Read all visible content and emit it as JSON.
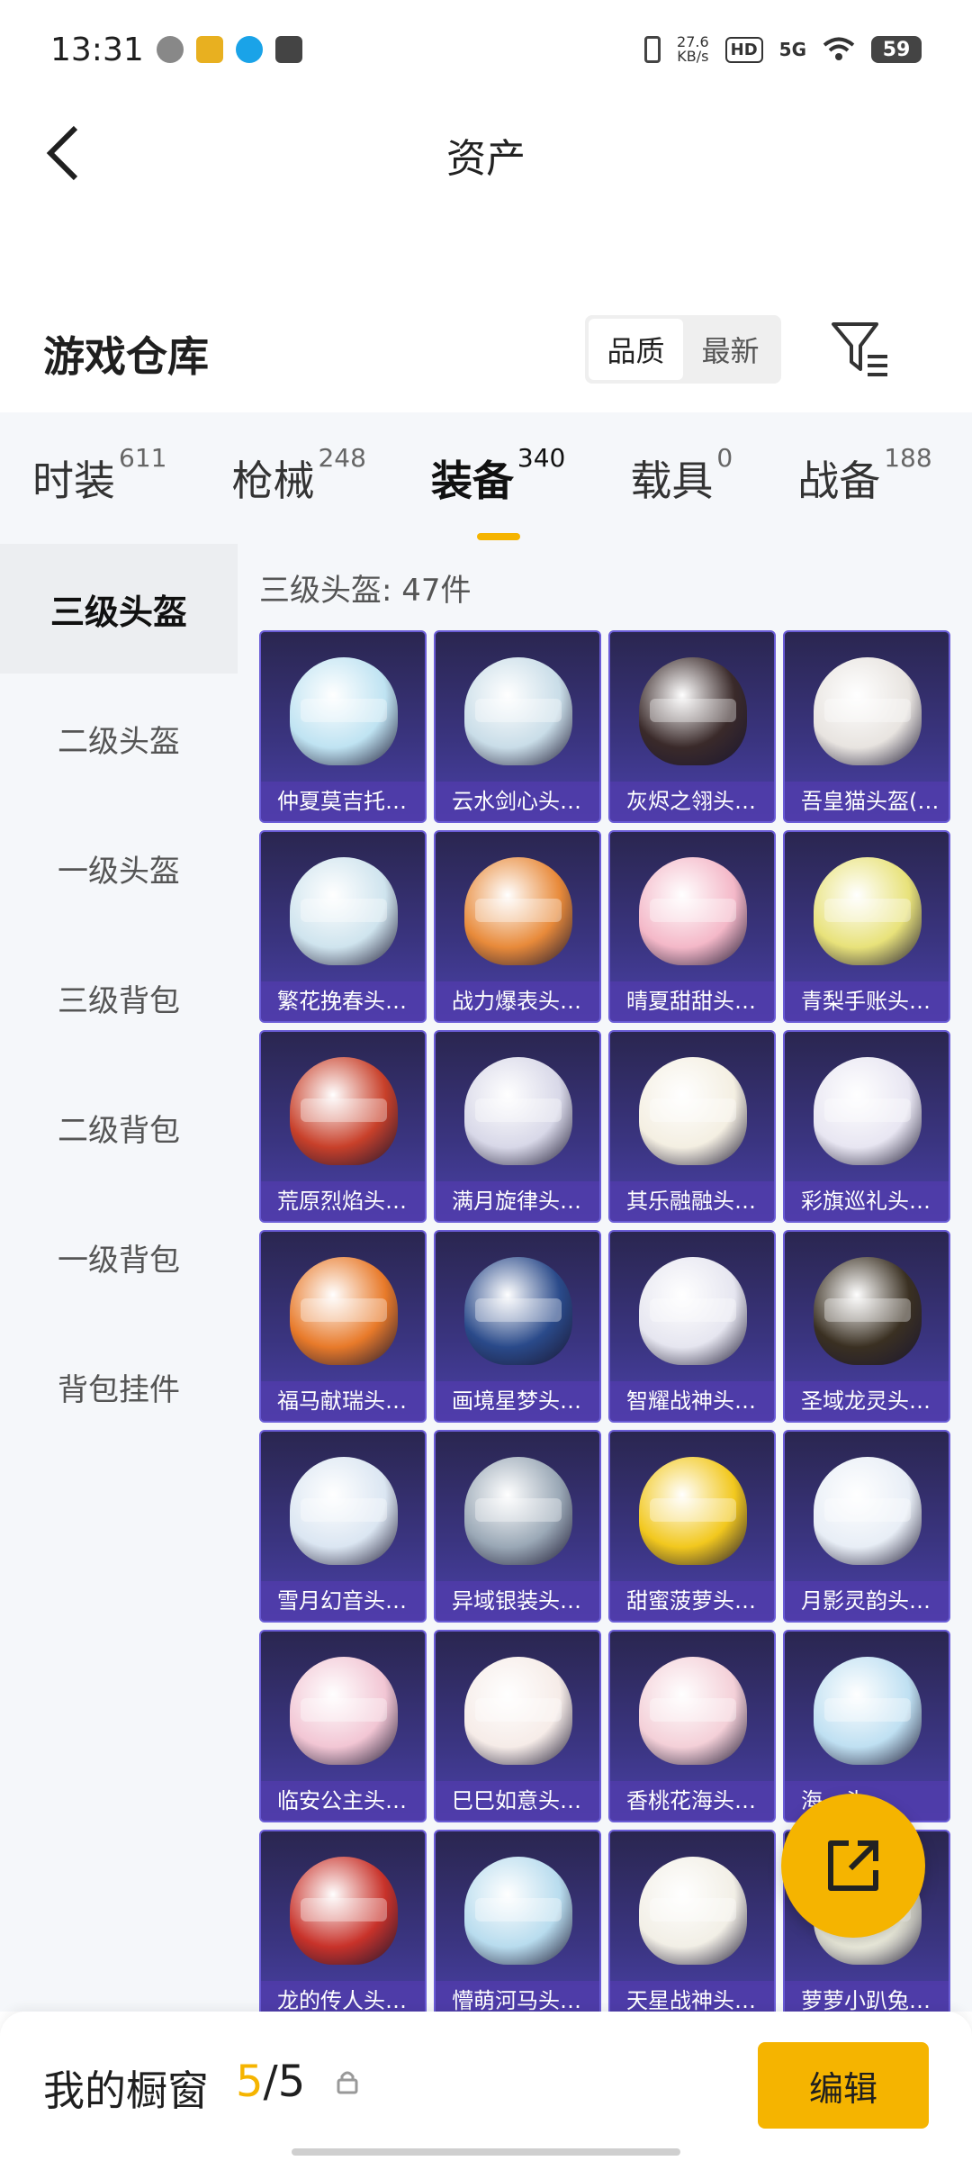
{
  "status_bar": {
    "time": "13:31",
    "net_speed_value": "27.6",
    "net_speed_unit": "KB/s",
    "hd_label": "HD",
    "network_label": "5G",
    "battery": "59"
  },
  "header": {
    "title": "资产"
  },
  "section": {
    "title": "游戏仓库",
    "sort_options": [
      "品质",
      "最新"
    ],
    "sort_selected": "品质"
  },
  "tabs": [
    {
      "label": "时装",
      "count": "611"
    },
    {
      "label": "枪械",
      "count": "248"
    },
    {
      "label": "装备",
      "count": "340"
    },
    {
      "label": "载具",
      "count": "0"
    },
    {
      "label": "战备",
      "count": "188"
    }
  ],
  "active_tab": "装备",
  "sidebar": {
    "items": [
      "三级头盔",
      "二级头盔",
      "一级头盔",
      "三级背包",
      "二级背包",
      "一级背包",
      "背包挂件"
    ],
    "active": "三级头盔"
  },
  "content": {
    "heading": "三级头盔: 47件",
    "items": [
      {
        "name": "仲夏莫吉托…",
        "color": "#bfe3f2"
      },
      {
        "name": "云水剑心头…",
        "color": "#c9dde8"
      },
      {
        "name": "灰烬之翎头…",
        "color": "#3a2a2a"
      },
      {
        "name": "吾皇猫头盔(…",
        "color": "#e8e4e0"
      },
      {
        "name": "繁花挽春头…",
        "color": "#cfe4ee"
      },
      {
        "name": "战力爆表头…",
        "color": "#e88a3a"
      },
      {
        "name": "晴夏甜甜头…",
        "color": "#f4b8c8"
      },
      {
        "name": "青梨手账头…",
        "color": "#e8e27a"
      },
      {
        "name": "荒原烈焰头…",
        "color": "#c8402a"
      },
      {
        "name": "满月旋律头…",
        "color": "#d8d8e8"
      },
      {
        "name": "其乐融融头…",
        "color": "#f4efe2"
      },
      {
        "name": "彩旗巡礼头…",
        "color": "#e8e6f2"
      },
      {
        "name": "福马献瑞头…",
        "color": "#e87a2a"
      },
      {
        "name": "画境星梦头…",
        "color": "#2a4a8a"
      },
      {
        "name": "智耀战神头…",
        "color": "#e6e6f0"
      },
      {
        "name": "圣域龙灵头…",
        "color": "#3a3022"
      },
      {
        "name": "雪月幻音头…",
        "color": "#dbe6f2"
      },
      {
        "name": "异域银装头…",
        "color": "#9aa8b6"
      },
      {
        "name": "甜蜜菠萝头…",
        "color": "#f2c81e"
      },
      {
        "name": "月影灵韵头…",
        "color": "#e8eef6"
      },
      {
        "name": "临安公主头…",
        "color": "#f2c6d4"
      },
      {
        "name": "巳巳如意头…",
        "color": "#f6ece8"
      },
      {
        "name": "香桃花海头…",
        "color": "#f4d0d8"
      },
      {
        "name": "海…头…",
        "color": "#bfe0f2"
      },
      {
        "name": "龙的传人头…",
        "color": "#c8322a"
      },
      {
        "name": "懵萌河马头…",
        "color": "#b8dcee"
      },
      {
        "name": "天星战神头…",
        "color": "#f2efe6"
      },
      {
        "name": "萝萝小趴兔…",
        "color": "#f2f2e2"
      }
    ]
  },
  "bottom_bar": {
    "label": "我的橱窗",
    "count_current": "5",
    "count_total": "/5",
    "edit_label": "编辑"
  },
  "colors": {
    "accent": "#f5b400",
    "card_border": "#6a5cd6",
    "card_label_bg": "#503caa"
  }
}
